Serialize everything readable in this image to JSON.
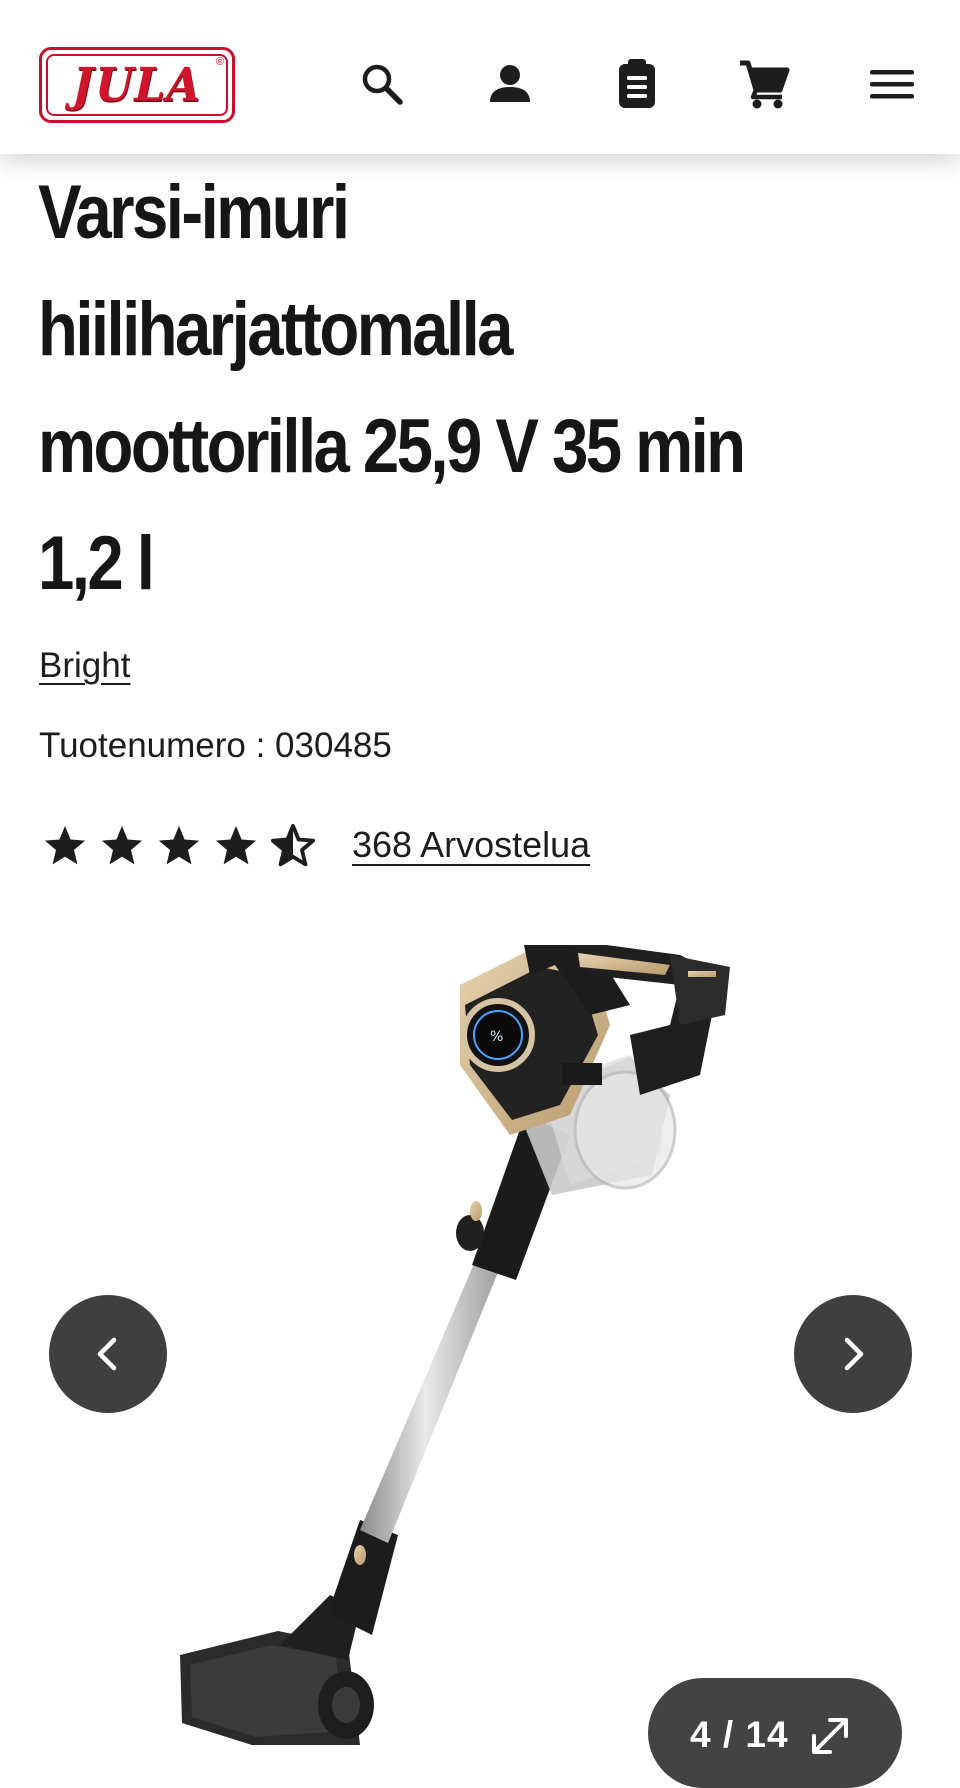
{
  "header": {
    "logo_text": "JULA",
    "logo_reg": "®",
    "icons": [
      "search-icon",
      "account-icon",
      "shopping-list-icon",
      "cart-icon",
      "menu-icon"
    ]
  },
  "product": {
    "title_lines": [
      "Varsi-imuri",
      "hiiliharjattomalla",
      "moottorilla 25,9 V 35 min",
      "1,2 l"
    ],
    "brand": "Bright",
    "sku_label": "Tuotenumero : 030485",
    "rating": 4.5,
    "rating_max": 5,
    "reviews_label": "368 Arvostelua"
  },
  "gallery": {
    "counter": "4 / 14",
    "prev_icon": "chevron-left-icon",
    "next_icon": "chevron-right-icon",
    "expand_icon": "expand-icon"
  },
  "colors": {
    "brand_red": "#c8102e",
    "text": "#1d1d1d",
    "button_bg": "#3f3f3f"
  }
}
